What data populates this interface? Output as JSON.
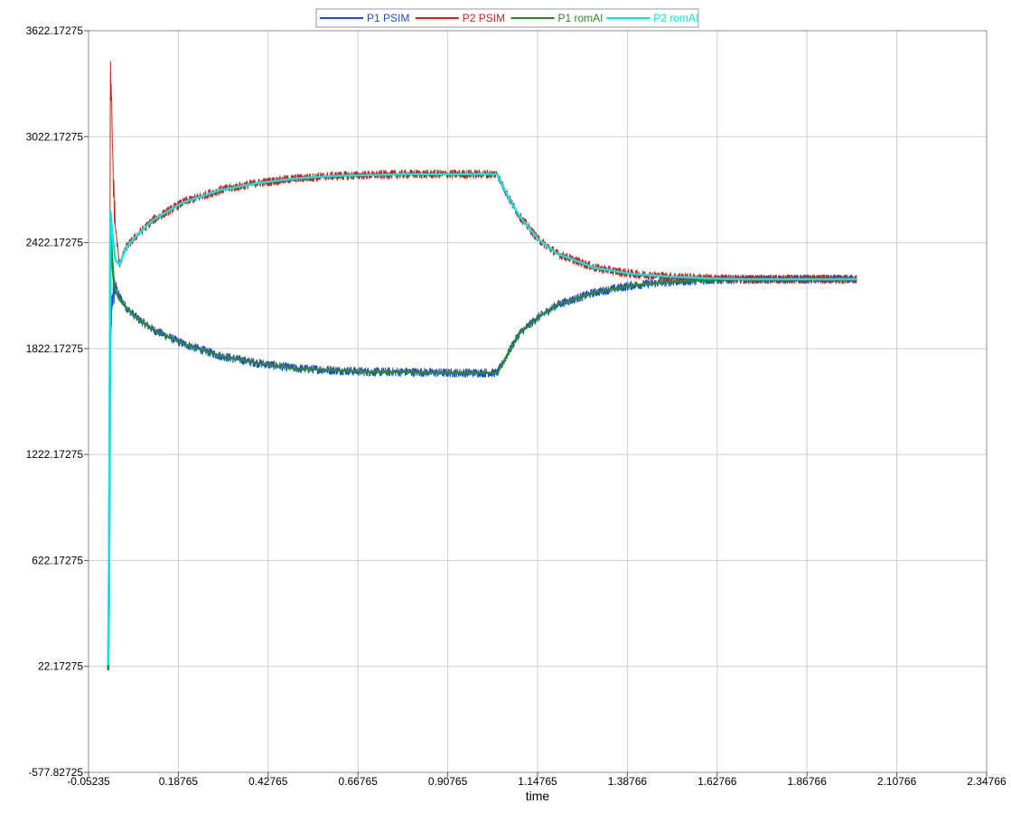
{
  "chart_data": {
    "type": "line",
    "title": "",
    "xlabel": "time",
    "ylabel": "",
    "xlim": [
      -0.05235,
      2.34766
    ],
    "ylim": [
      -577.82725,
      3622.17275
    ],
    "x_ticks": [
      -0.05235,
      0.18765,
      0.42765,
      0.66765,
      0.90765,
      1.14765,
      1.38766,
      1.62766,
      1.86766,
      2.10766,
      2.34766
    ],
    "x_tick_labels": [
      "-0.05235",
      "0.18765",
      "0.42765",
      "0.66765",
      "0.90765",
      "1.14765",
      "1.38766",
      "1.62766",
      "1.86766",
      "2.10766",
      "2.34766"
    ],
    "y_ticks": [
      -577.82725,
      22.17275,
      622.17275,
      1222.17275,
      1822.17275,
      2422.17275,
      3022.17275,
      3622.17275
    ],
    "y_tick_labels": [
      "-577.82725",
      "22.17275",
      "622.17275",
      "1222.17275",
      "1822.17275",
      "2422.17275",
      "3022.17275",
      "3622.17275"
    ],
    "grid": true,
    "legend_position": "top-center",
    "series": [
      {
        "name": "P1 PSIM",
        "color": "#1f4fbf",
        "x": [
          0.0,
          0.003,
          0.006,
          0.01,
          0.015,
          0.02,
          0.03,
          0.05,
          0.08,
          0.12,
          0.2,
          0.3,
          0.4,
          0.5,
          0.6,
          0.7,
          0.8,
          0.9,
          1.0,
          1.04,
          1.06,
          1.08,
          1.1,
          1.15,
          1.2,
          1.3,
          1.4,
          1.5,
          1.6,
          1.7,
          1.8,
          1.9,
          2.0
        ],
        "y": [
          0,
          400,
          1700,
          2100,
          2150,
          2180,
          2120,
          2050,
          1990,
          1930,
          1850,
          1780,
          1740,
          1710,
          1700,
          1690,
          1690,
          1685,
          1685,
          1685,
          1760,
          1840,
          1910,
          2000,
          2070,
          2140,
          2180,
          2200,
          2210,
          2215,
          2215,
          2215,
          2215
        ],
        "noise": 25
      },
      {
        "name": "P2 PSIM",
        "color": "#c0281c",
        "x": [
          0.0,
          0.003,
          0.006,
          0.01,
          0.015,
          0.02,
          0.03,
          0.05,
          0.08,
          0.12,
          0.2,
          0.3,
          0.4,
          0.5,
          0.6,
          0.7,
          0.8,
          0.9,
          1.0,
          1.04,
          1.06,
          1.08,
          1.1,
          1.15,
          1.2,
          1.3,
          1.4,
          1.5,
          1.6,
          1.7,
          1.8,
          1.9,
          2.0
        ],
        "y": [
          0,
          600,
          3400,
          3100,
          2700,
          2500,
          2300,
          2400,
          2470,
          2550,
          2650,
          2720,
          2760,
          2785,
          2800,
          2805,
          2810,
          2810,
          2810,
          2810,
          2720,
          2640,
          2570,
          2440,
          2360,
          2280,
          2245,
          2230,
          2220,
          2215,
          2215,
          2215,
          2215
        ],
        "noise": 25
      },
      {
        "name": "P1 romAI",
        "color": "#2a8a2a",
        "x": [
          0.0,
          0.003,
          0.006,
          0.01,
          0.015,
          0.02,
          0.03,
          0.05,
          0.08,
          0.12,
          0.2,
          0.3,
          0.4,
          0.5,
          0.6,
          0.7,
          0.8,
          0.9,
          1.0,
          1.04,
          1.06,
          1.08,
          1.1,
          1.15,
          1.2,
          1.3,
          1.4,
          1.5,
          1.6,
          1.7,
          1.8,
          1.9,
          2.0
        ],
        "y": [
          0,
          500,
          2500,
          2350,
          2200,
          2150,
          2100,
          2050,
          1990,
          1930,
          1850,
          1780,
          1740,
          1710,
          1700,
          1690,
          1690,
          1685,
          1685,
          1685,
          1760,
          1840,
          1910,
          2000,
          2070,
          2140,
          2180,
          2200,
          2210,
          2215,
          2215,
          2215,
          2215
        ],
        "noise": 0
      },
      {
        "name": "P2 romAI",
        "color": "#00e5e5",
        "x": [
          0.0,
          0.003,
          0.006,
          0.01,
          0.015,
          0.02,
          0.03,
          0.05,
          0.08,
          0.12,
          0.2,
          0.3,
          0.4,
          0.5,
          0.6,
          0.7,
          0.8,
          0.9,
          1.0,
          1.04,
          1.06,
          1.08,
          1.1,
          1.15,
          1.2,
          1.3,
          1.4,
          1.5,
          1.6,
          1.7,
          1.8,
          1.9,
          2.0
        ],
        "y": [
          30,
          600,
          2600,
          2500,
          2400,
          2320,
          2300,
          2400,
          2470,
          2550,
          2650,
          2720,
          2760,
          2785,
          2800,
          2805,
          2810,
          2810,
          2810,
          2810,
          2720,
          2640,
          2570,
          2440,
          2360,
          2280,
          2245,
          2230,
          2220,
          2215,
          2215,
          2215,
          2215
        ],
        "noise": 0
      }
    ]
  }
}
